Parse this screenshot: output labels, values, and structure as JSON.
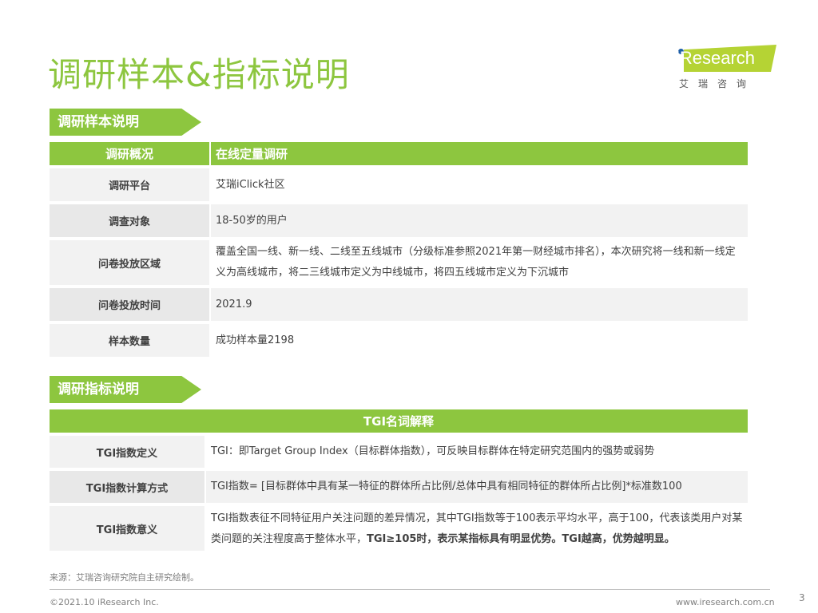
{
  "title": "调研样本&指标说明",
  "logo": {
    "brand": "iResearch",
    "cn": "艾瑞咨询"
  },
  "section1": {
    "banner": "调研样本说明",
    "header": {
      "label": "调研概况",
      "value": "在线定量调研"
    },
    "rows": [
      {
        "label": "调研平台",
        "value": "艾瑞iClick社区"
      },
      {
        "label": "调查对象",
        "value": "18-50岁的用户"
      },
      {
        "label": "问卷投放区域",
        "value": "覆盖全国一线、新一线、二线至五线城市（分级标准参照2021年第一财经城市排名），本次研究将一线和新一线定义为高线城市，将二三线城市定义为中线城市，将四五线城市定义为下沉城市"
      },
      {
        "label": "问卷投放时间",
        "value": "2021.9"
      },
      {
        "label": "样本数量",
        "value": "成功样本量2198"
      }
    ]
  },
  "section2": {
    "banner": "调研指标说明",
    "header": "TGI名词解释",
    "rows": [
      {
        "label": "TGI指数定义",
        "value": "TGI：即Target Group Index（目标群体指数），可反映目标群体在特定研究范围内的强势或弱势"
      },
      {
        "label": "TGI指数计算方式",
        "value": "TGI指数= [目标群体中具有某一特征的群体所占比例/总体中具有相同特征的群体所占比例]*标准数100"
      },
      {
        "label": "TGI指数意义",
        "value": "TGI指数表征不同特征用户关注问题的差异情况，其中TGI指数等于100表示平均水平，高于100，代表该类用户对某类问题的关注程度高于整体水平，",
        "value_bold": "TGI≥105时，表示某指标具有明显优势。TGI越高，优势越明显。"
      }
    ]
  },
  "source": "来源：艾瑞咨询研究院自主研究绘制。",
  "footer": {
    "copyright": "©2021.10 iResearch Inc.",
    "url": "www.iresearch.com.cn",
    "page": "3"
  }
}
